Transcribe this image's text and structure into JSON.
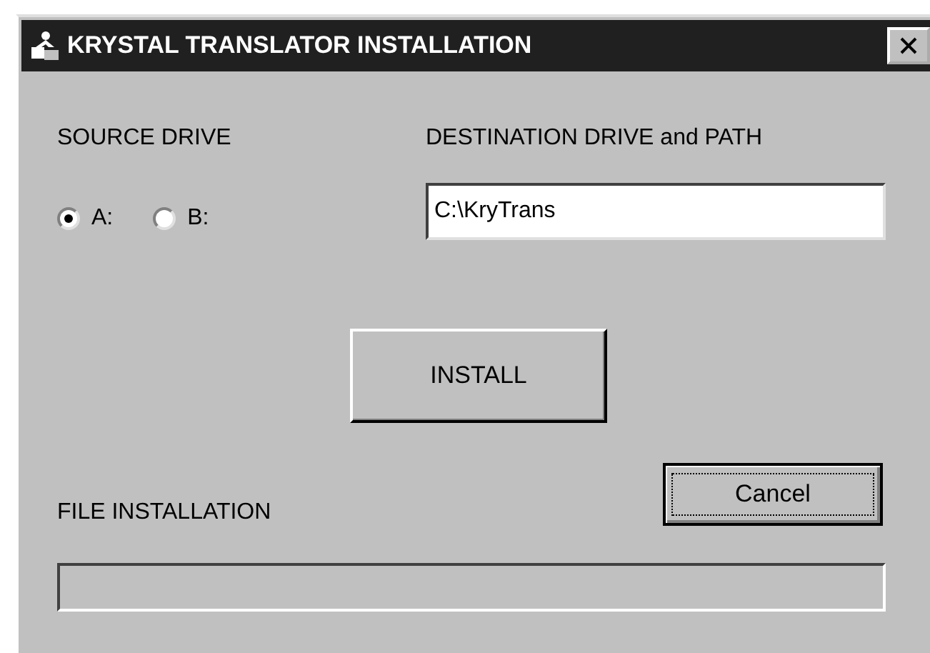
{
  "window": {
    "title": "KRYSTAL TRANSLATOR INSTALLATION"
  },
  "source_drive": {
    "label": "SOURCE DRIVE",
    "options": [
      {
        "label": "A:",
        "selected": true
      },
      {
        "label": "B:",
        "selected": false
      }
    ]
  },
  "destination": {
    "label": "DESTINATION DRIVE and PATH",
    "value": "C:\\KryTrans"
  },
  "buttons": {
    "install": "INSTALL",
    "cancel": "Cancel"
  },
  "file_installation": {
    "label": "FILE INSTALLATION",
    "level": 0
  }
}
